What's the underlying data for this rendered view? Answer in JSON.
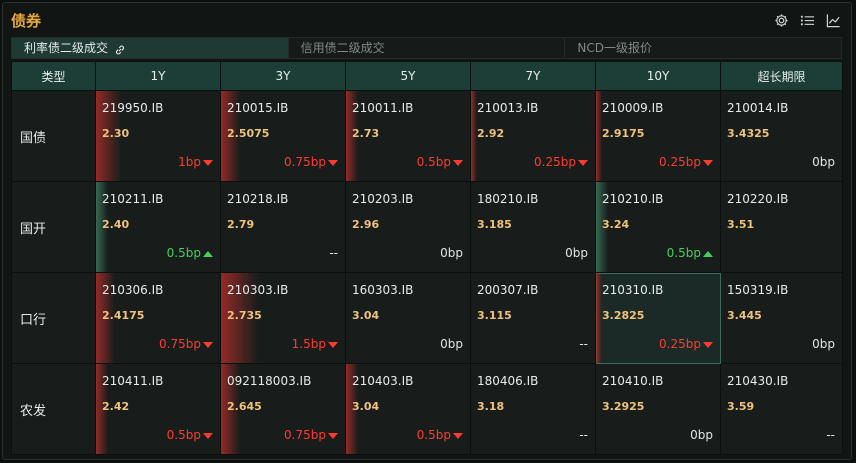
{
  "panel": {
    "title": "债券",
    "icons": [
      "gear-icon",
      "list-icon",
      "line-chart-icon"
    ]
  },
  "tabs": [
    {
      "label": "利率债二级成交",
      "active": true,
      "icon": "link-icon"
    },
    {
      "label": "信用债二级成交",
      "active": false
    },
    {
      "label": "NCD一级报价",
      "active": false
    }
  ],
  "table": {
    "headers": [
      "类型",
      "1Y",
      "3Y",
      "5Y",
      "7Y",
      "10Y",
      "超长期限"
    ],
    "rows": [
      {
        "type": "国债",
        "cells": [
          {
            "code": "219950.IB",
            "yield": "2.30",
            "change": "1bp",
            "dir": "down",
            "bar": 0.2
          },
          {
            "code": "210015.IB",
            "yield": "2.5075",
            "change": "0.75bp",
            "dir": "down",
            "bar": 0.15
          },
          {
            "code": "210011.IB",
            "yield": "2.73",
            "change": "0.5bp",
            "dir": "down",
            "bar": 0.1
          },
          {
            "code": "210013.IB",
            "yield": "2.92",
            "change": "0.25bp",
            "dir": "down",
            "bar": 0.05
          },
          {
            "code": "210009.IB",
            "yield": "2.9175",
            "change": "0.25bp",
            "dir": "down",
            "bar": 0.05
          },
          {
            "code": "210014.IB",
            "yield": "3.4325",
            "change": "0bp",
            "dir": "flat",
            "bar": 0
          }
        ]
      },
      {
        "type": "国开",
        "cells": [
          {
            "code": "210211.IB",
            "yield": "2.40",
            "change": "0.5bp",
            "dir": "up",
            "bar": 0.1
          },
          {
            "code": "210218.IB",
            "yield": "2.79",
            "change": "--",
            "dir": "flat",
            "bar": 0
          },
          {
            "code": "210203.IB",
            "yield": "2.96",
            "change": "0bp",
            "dir": "flat",
            "bar": 0
          },
          {
            "code": "180210.IB",
            "yield": "3.185",
            "change": "0bp",
            "dir": "flat",
            "bar": 0
          },
          {
            "code": "210210.IB",
            "yield": "3.24",
            "change": "0.5bp",
            "dir": "up",
            "bar": 0.1
          },
          {
            "code": "210220.IB",
            "yield": "3.51",
            "change": "",
            "dir": "flat",
            "bar": 0
          }
        ]
      },
      {
        "type": "口行",
        "cells": [
          {
            "code": "210306.IB",
            "yield": "2.4175",
            "change": "0.75bp",
            "dir": "down",
            "bar": 0.15
          },
          {
            "code": "210303.IB",
            "yield": "2.735",
            "change": "1.5bp",
            "dir": "down",
            "bar": 0.3
          },
          {
            "code": "160303.IB",
            "yield": "3.04",
            "change": "0bp",
            "dir": "flat",
            "bar": 0
          },
          {
            "code": "200307.IB",
            "yield": "3.115",
            "change": "--",
            "dir": "flat",
            "bar": 0
          },
          {
            "code": "210310.IB",
            "yield": "3.2825",
            "change": "0.25bp",
            "dir": "down",
            "bar": 0.05,
            "selected": true
          },
          {
            "code": "150319.IB",
            "yield": "3.445",
            "change": "0bp",
            "dir": "flat",
            "bar": 0
          }
        ]
      },
      {
        "type": "农发",
        "cells": [
          {
            "code": "210411.IB",
            "yield": "2.42",
            "change": "0.5bp",
            "dir": "down",
            "bar": 0.1
          },
          {
            "code": "092118003.IB",
            "yield": "2.645",
            "change": "0.75bp",
            "dir": "down",
            "bar": 0.15
          },
          {
            "code": "210403.IB",
            "yield": "3.04",
            "change": "0.5bp",
            "dir": "down",
            "bar": 0.1
          },
          {
            "code": "180406.IB",
            "yield": "3.18",
            "change": "--",
            "dir": "flat",
            "bar": 0
          },
          {
            "code": "210410.IB",
            "yield": "3.2925",
            "change": "0bp",
            "dir": "flat",
            "bar": 0
          },
          {
            "code": "210430.IB",
            "yield": "3.59",
            "change": "--",
            "dir": "flat",
            "bar": 0
          }
        ]
      }
    ]
  }
}
